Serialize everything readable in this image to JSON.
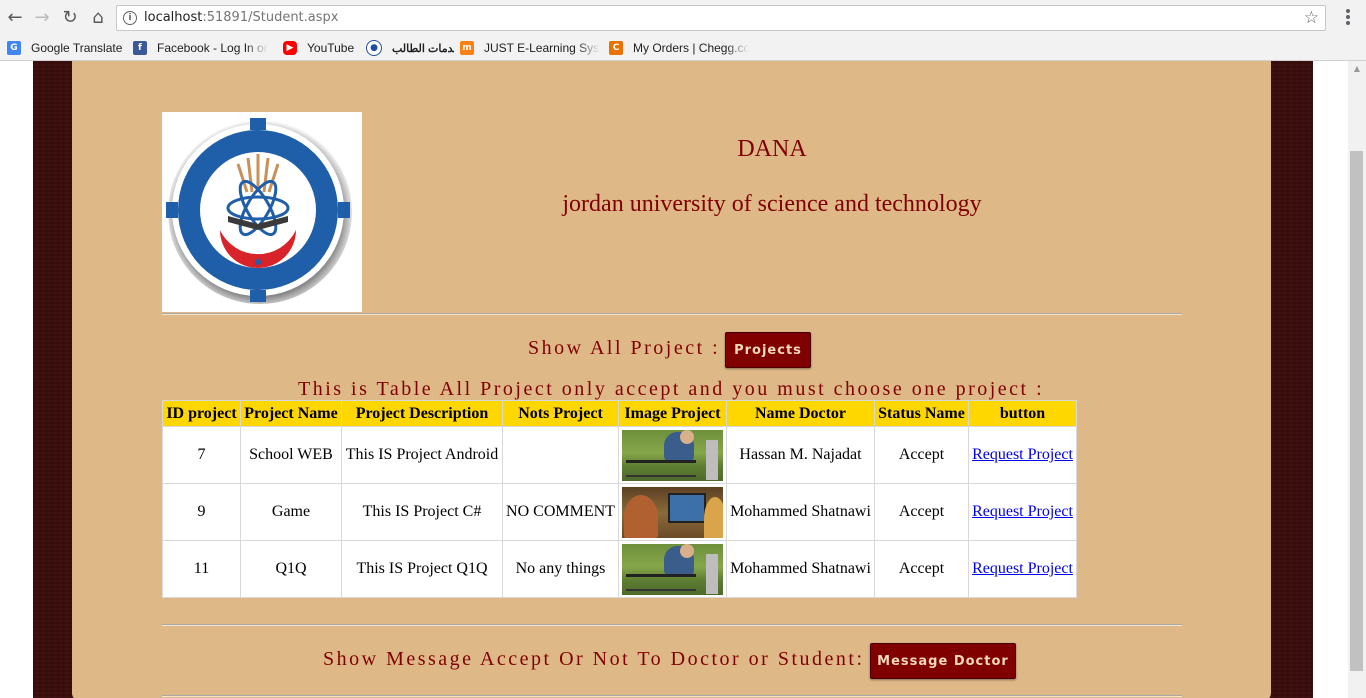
{
  "browser": {
    "url_host": "localhost",
    "url_path": ":51891/Student.aspx",
    "bookmarks": [
      {
        "label": "Google Translate",
        "icon": "google-translate-icon",
        "color": "#4285f4"
      },
      {
        "label": "Facebook - Log In or",
        "icon": "facebook-icon",
        "color": "#3b5998"
      },
      {
        "label": "YouTube",
        "icon": "youtube-icon",
        "color": "#ff0000"
      },
      {
        "label": "خدمات الطالب",
        "icon": "just-logo-icon",
        "color": "#1f4e9e"
      },
      {
        "label": "JUST E-Learning Syste",
        "icon": "moodle-icon",
        "color": "#f98012"
      },
      {
        "label": "My Orders | Chegg.cc",
        "icon": "chegg-icon",
        "color": "#eb7100"
      }
    ]
  },
  "header": {
    "title": "DANA",
    "subtitle": "jordan university of science and technology"
  },
  "projects_section": {
    "label": "Show All Project :",
    "button": "Projects",
    "table_caption": "This is Table All Project only accept and you must choose one project :"
  },
  "table": {
    "columns": [
      "ID project",
      "Project Name",
      "Project Description",
      "Nots Project",
      "Image Project",
      "Name Doctor",
      "Status Name",
      "button"
    ],
    "rows": [
      {
        "id": "7",
        "name": "School WEB",
        "description": "This IS Project Android",
        "notes": "",
        "image": "drone",
        "doctor": "Hassan M. Najadat",
        "status": "Accept",
        "action": "Request Project"
      },
      {
        "id": "9",
        "name": "Game",
        "description": "This IS Project C#",
        "notes": "NO COMMENT",
        "image": "laptop",
        "doctor": "Mohammed Shatnawi",
        "status": "Accept",
        "action": "Request Project"
      },
      {
        "id": "11",
        "name": "Q1Q",
        "description": "This IS Project Q1Q",
        "notes": "No any things",
        "image": "drone",
        "doctor": "Mohammed Shatnawi",
        "status": "Accept",
        "action": "Request Project"
      }
    ]
  },
  "message_section": {
    "label": "Show Message Accept Or Not To Doctor or Student:",
    "button": "Message Doctor"
  },
  "colors": {
    "panel": "#deb887",
    "accent": "#800000",
    "header_row": "#ffd700"
  }
}
